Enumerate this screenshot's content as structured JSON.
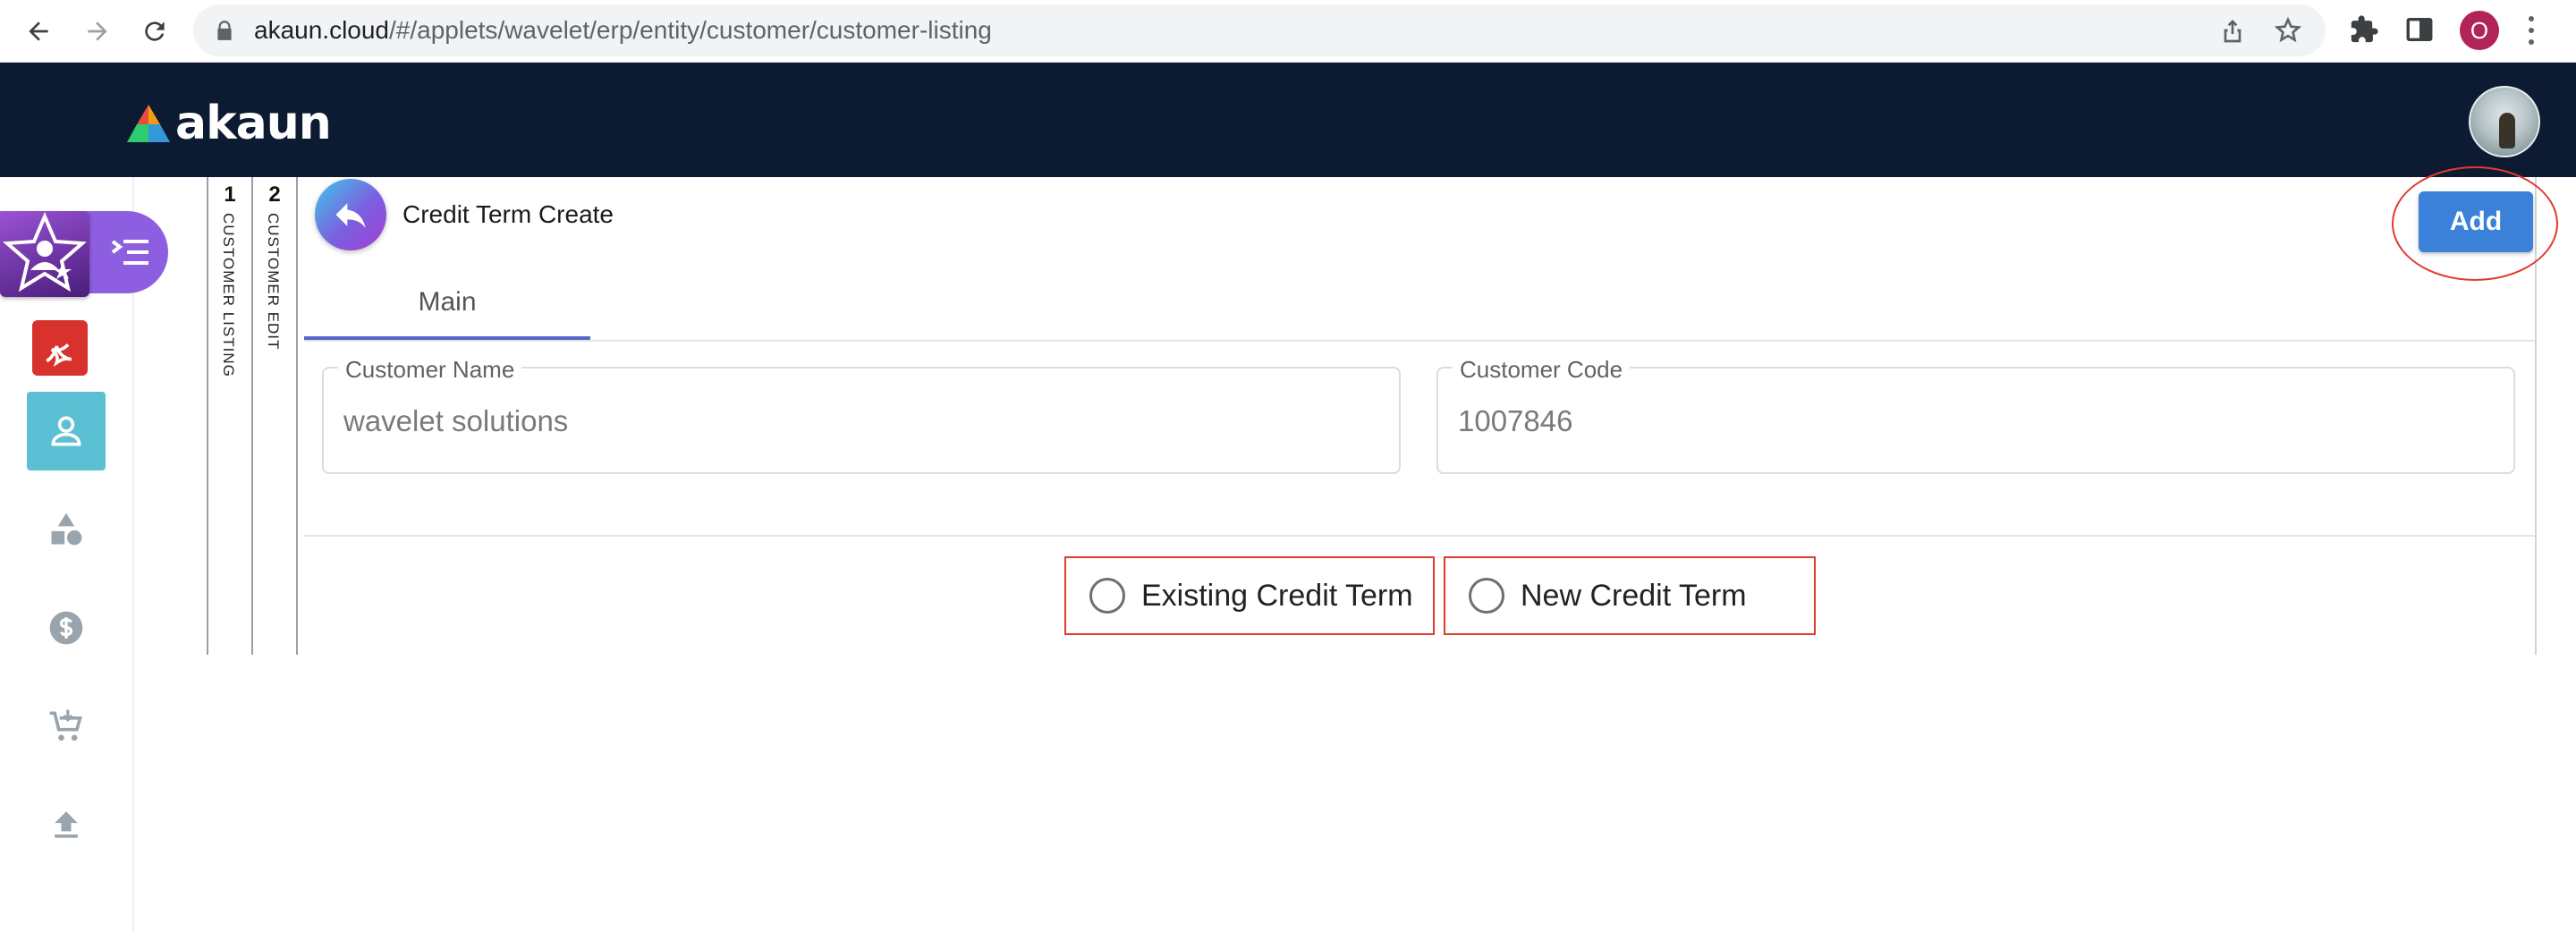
{
  "browser": {
    "url_host": "akaun.cloud",
    "url_path": "/#/applets/wavelet/erp/entity/customer/customer-listing",
    "profile_initial": "O"
  },
  "app": {
    "logo_text": "akaun"
  },
  "sidebar": {
    "items": [
      {
        "name": "applet",
        "icon": "user-star-icon"
      },
      {
        "name": "tool",
        "icon": "red-app-icon"
      },
      {
        "name": "customer",
        "icon": "person-icon",
        "active": true
      },
      {
        "name": "shapes",
        "icon": "shapes-icon"
      },
      {
        "name": "pricing",
        "icon": "dollar-icon"
      },
      {
        "name": "cart",
        "icon": "cart-icon"
      },
      {
        "name": "upload",
        "icon": "upload-icon"
      }
    ]
  },
  "vertical_tabs": [
    {
      "number": "1",
      "label": "CUSTOMER LISTING"
    },
    {
      "number": "2",
      "label": "CUSTOMER EDIT"
    }
  ],
  "page": {
    "title": "Credit Term Create",
    "add_label": "Add",
    "tab_main": "Main"
  },
  "form": {
    "customer_name_label": "Customer Name",
    "customer_name_value": "wavelet solutions",
    "customer_code_label": "Customer Code",
    "customer_code_value": "1007846"
  },
  "options": {
    "existing": "Existing Credit Term",
    "new": "New Credit Term"
  },
  "colors": {
    "header_bg": "#0c1a32",
    "accent_blue": "#3b80d9",
    "highlight_red": "#e03b2f",
    "active_sidebar": "#5bc0d3"
  }
}
